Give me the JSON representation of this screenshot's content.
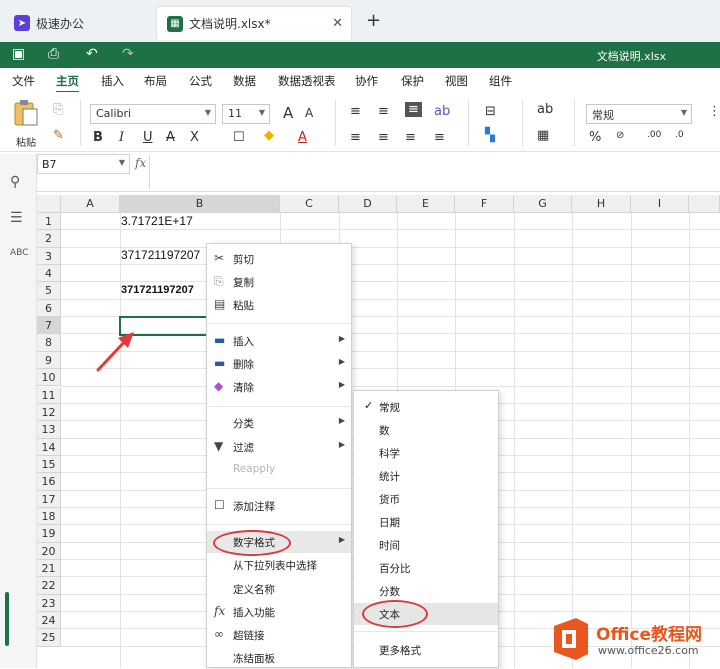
{
  "tabs": [
    {
      "label": "极速办公",
      "active": false
    },
    {
      "label": "文档说明.xlsx*",
      "active": true
    }
  ],
  "new_tab_label": "+",
  "file_title": "文档说明.xlsx",
  "menu": [
    "文件",
    "主页",
    "插入",
    "布局",
    "公式",
    "数据",
    "数据透视表",
    "协作",
    "保护",
    "视图",
    "组件"
  ],
  "menu_active": "主页",
  "ribbon": {
    "paste_label": "粘贴",
    "font_name": "Calibri",
    "font_size": "11",
    "number_format": "常规",
    "bold": "B",
    "italic": "I",
    "underline": "U",
    "strike": "A",
    "sub": "X",
    "grow_font": "A",
    "shrink_font": "A",
    "font_color": "A",
    "percent": "%"
  },
  "formula_bar": {
    "cell_ref": "B7",
    "fx": "fx"
  },
  "grid": {
    "columns": [
      "A",
      "B",
      "C",
      "D",
      "E",
      "F",
      "G",
      "H",
      "I"
    ],
    "rows": [
      "1",
      "2",
      "3",
      "4",
      "5",
      "6",
      "7",
      "8",
      "9",
      "10",
      "11",
      "12",
      "13",
      "14",
      "15",
      "16",
      "17",
      "18",
      "19",
      "20",
      "21",
      "22",
      "23",
      "24",
      "25"
    ],
    "selected_column": "B",
    "selected_row": "7",
    "cells": {
      "b1": "3.71721E+17",
      "b3": "371721197207",
      "b5": "371721197207"
    }
  },
  "context_menu": {
    "items": [
      {
        "icon": "scissors-icon",
        "label": "剪切"
      },
      {
        "icon": "copy-icon",
        "label": "复制"
      },
      {
        "icon": "paste-icon",
        "label": "粘贴"
      },
      {
        "icon": "insert-icon",
        "label": "插入",
        "submenu": true
      },
      {
        "icon": "delete-icon",
        "label": "删除",
        "submenu": true
      },
      {
        "icon": "eraser-icon",
        "label": "清除",
        "submenu": true
      },
      {
        "icon": "",
        "label": "分类",
        "submenu": true
      },
      {
        "icon": "filter-icon",
        "label": "过滤",
        "submenu": true
      },
      {
        "icon": "",
        "label": "Reapply",
        "disabled": true
      },
      {
        "icon": "comment-icon",
        "label": "添加注释"
      },
      {
        "icon": "",
        "label": "数字格式",
        "submenu": true,
        "highlighted": true
      },
      {
        "icon": "",
        "label": "从下拉列表中选择"
      },
      {
        "icon": "",
        "label": "定义名称"
      },
      {
        "icon": "function-icon",
        "label": "插入功能"
      },
      {
        "icon": "link-icon",
        "label": "超链接"
      },
      {
        "icon": "",
        "label": "冻结面板"
      }
    ]
  },
  "number_format_menu": {
    "items": [
      "常规",
      "数",
      "科学",
      "统计",
      "货币",
      "日期",
      "时间",
      "百分比",
      "分数",
      "文本",
      "更多格式"
    ],
    "checked": "常规",
    "highlighted": "文本"
  },
  "watermark": {
    "brand": "Office教程网",
    "url": "www.office26.com"
  },
  "colors": {
    "accent": "#1e7145",
    "annotation": "#d63d3d",
    "watermark_orange": "#e8571e"
  }
}
